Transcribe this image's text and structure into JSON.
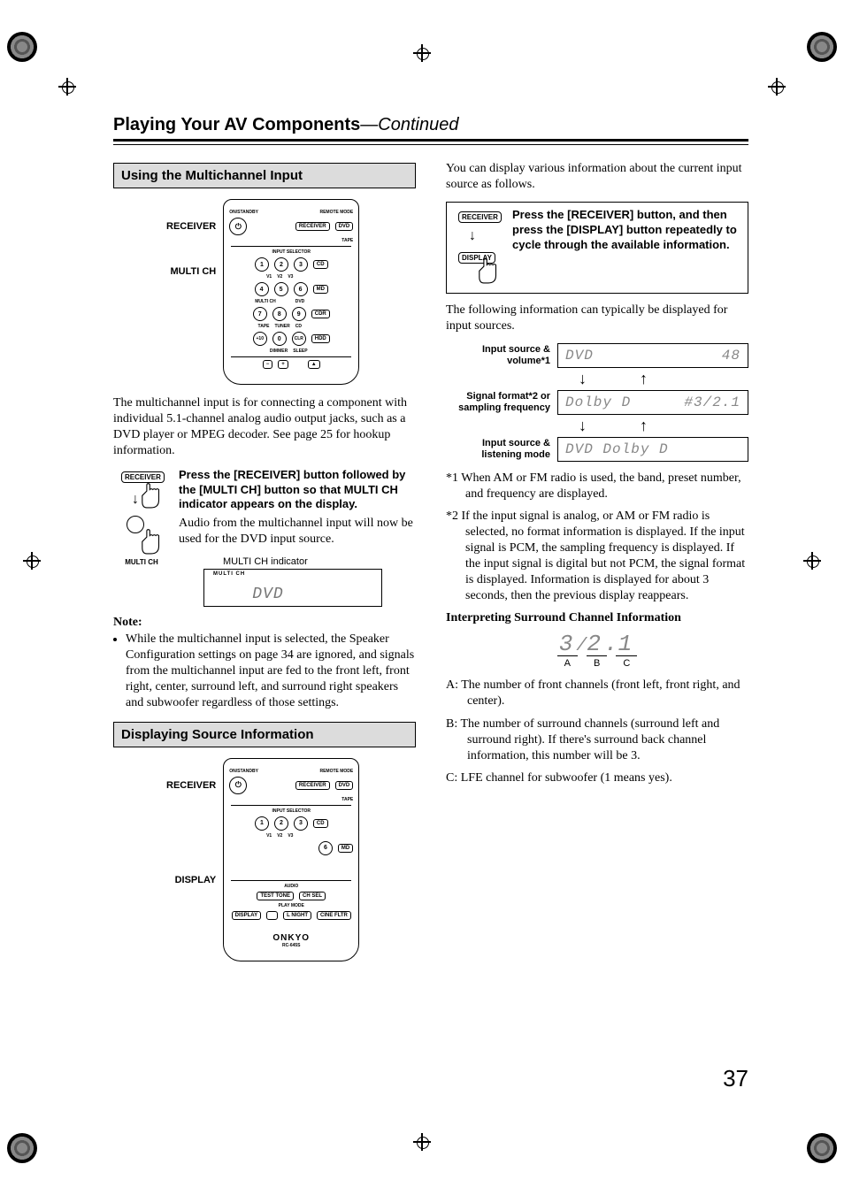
{
  "page_number": "37",
  "title_main": "Playing Your AV Components",
  "title_cont": "—Continued",
  "sectionA": {
    "heading": "Using the Multichannel Input",
    "callout1": "RECEIVER",
    "callout2": "MULTI CH",
    "para1": "The multichannel input is for connecting a component with individual 5.1-channel analog audio output jacks, such as a DVD player or MPEG decoder. See page 25 for hookup information.",
    "instr_bold": "Press the [RECEIVER] button followed by the [MULTI CH] button so that MULTI CH indicator appears on the display.",
    "instr_body": "Audio from the multichannel input will now be used for the DVD input source.",
    "indicator_label": "MULTI CH indicator",
    "panel_marker": "MULTI CH",
    "panel_text": "DVD",
    "multich_lbl": "MULTI CH",
    "note_head": "Note:",
    "note_item": "While the multichannel input is selected, the Speaker Configuration settings on page 34 are ignored, and signals from the multichannel input are fed to the front left, front right, center, surround left, and surround right speakers and subwoofer regardless of those settings."
  },
  "sectionB": {
    "heading": "Displaying Source Information",
    "callout1": "RECEIVER",
    "callout2": "DISPLAY",
    "remote_brand": "ONKYO",
    "remote_model": "RC-645S"
  },
  "remote": {
    "on_standby": "ON/STANDBY",
    "remote_mode": "REMOTE MODE",
    "receiver": "RECEIVER",
    "dvd": "DVD",
    "tape": "TAPE",
    "input_selector": "INPUT SELECTOR",
    "cd": "CD",
    "md": "MD",
    "cdr": "CDR",
    "hdd": "HDD",
    "v1": "V1",
    "v2": "V2",
    "v3": "V3",
    "multich": "MULTI CH",
    "tuner": "TUNER",
    "dimmer": "DIMMER",
    "sleep": "SLEEP",
    "clr": "CLR",
    "plus10": "+10",
    "audio": "AUDIO",
    "testtone": "TEST TONE",
    "chsel": "CH SEL",
    "playmode": "PLAY MODE",
    "display": "DISPLAY",
    "lnight": "L NIGHT",
    "cinefltr": "CINE FLTR"
  },
  "right": {
    "intro": "You can display various information about the current input source as follows.",
    "instr_bold": "Press the [RECEIVER] button, and then press the [DISPLAY] button repeatedly to cycle through the available information.",
    "para2": "The following information can typically be displayed for input sources.",
    "d1_lbl": "Input source & volume*1",
    "d1_left": "DVD",
    "d1_right": "48",
    "d2_lbl": "Signal format*2 or sampling frequency",
    "d2_left": "Dolby D",
    "d2_right": "#3/2.1",
    "d3_lbl": "Input source & listening mode",
    "d3_left": "DVD Dolby D",
    "star1": "*1  When AM or FM radio is used, the band, preset number, and frequency are displayed.",
    "star2": "*2  If the input signal is analog, or AM or FM radio is selected, no format information is displayed. If the input signal is PCM, the sampling frequency is displayed. If the input signal is digital but not PCM, the signal format is displayed. Information is displayed for about 3 seconds, then the previous display reappears.",
    "sub_heading": "Interpreting Surround Channel Information",
    "fig_text": "3/2.1",
    "fig_A": "A",
    "fig_B": "B",
    "fig_C": "C",
    "abc_A": "A:  The number of front channels (front left, front right, and center).",
    "abc_B": "B:  The number of surround channels (surround left and surround right). If there's surround back channel information, this number will be 3.",
    "abc_C": "C:  LFE channel for subwoofer (1 means yes)."
  },
  "icons": {
    "receiver_pill": "RECEIVER",
    "display_pill": "DISPLAY"
  }
}
